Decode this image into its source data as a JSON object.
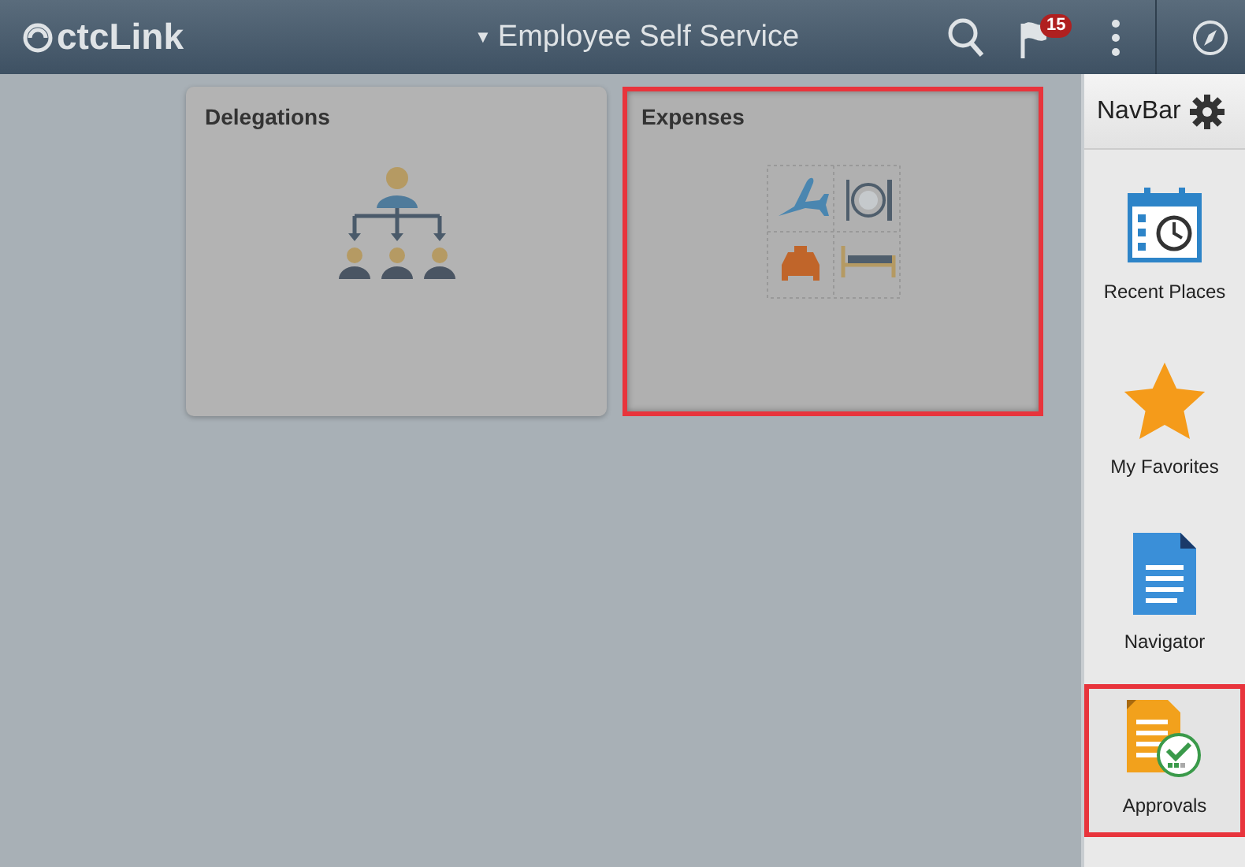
{
  "header": {
    "logo": "ctcLink",
    "title_caret": "▼",
    "title": "Employee Self Service",
    "notifications_badge": "15"
  },
  "tiles": [
    {
      "title": "Delegations",
      "kind": "delegations",
      "highlighted": false
    },
    {
      "title": "Expenses",
      "kind": "expenses",
      "highlighted": true
    }
  ],
  "navbar": {
    "title": "NavBar",
    "items": [
      {
        "label": "Recent Places",
        "kind": "recent",
        "highlighted": false
      },
      {
        "label": "My Favorites",
        "kind": "favorites",
        "highlighted": false
      },
      {
        "label": "Navigator",
        "kind": "navigator",
        "highlighted": false
      },
      {
        "label": "Approvals",
        "kind": "approvals",
        "highlighted": true
      }
    ]
  }
}
